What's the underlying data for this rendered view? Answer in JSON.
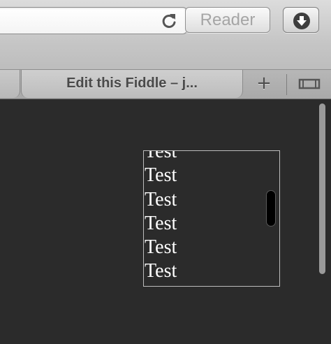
{
  "toolbar": {
    "address_value": "",
    "reader_label": "Reader",
    "reload_icon": "reload-icon",
    "download_icon": "download-icon"
  },
  "tabs": {
    "active_tab_title": "Edit this Fiddle – j...",
    "new_tab_label": "+",
    "tab_view_icon": "tab-overview-icon"
  },
  "scroll_box": {
    "items": [
      "Test",
      "Test",
      "Test",
      "Test",
      "Test",
      "Test"
    ]
  },
  "colors": {
    "page_background": "#2b2b2b",
    "box_border": "#bdbdbd",
    "text": "#ffffff"
  }
}
